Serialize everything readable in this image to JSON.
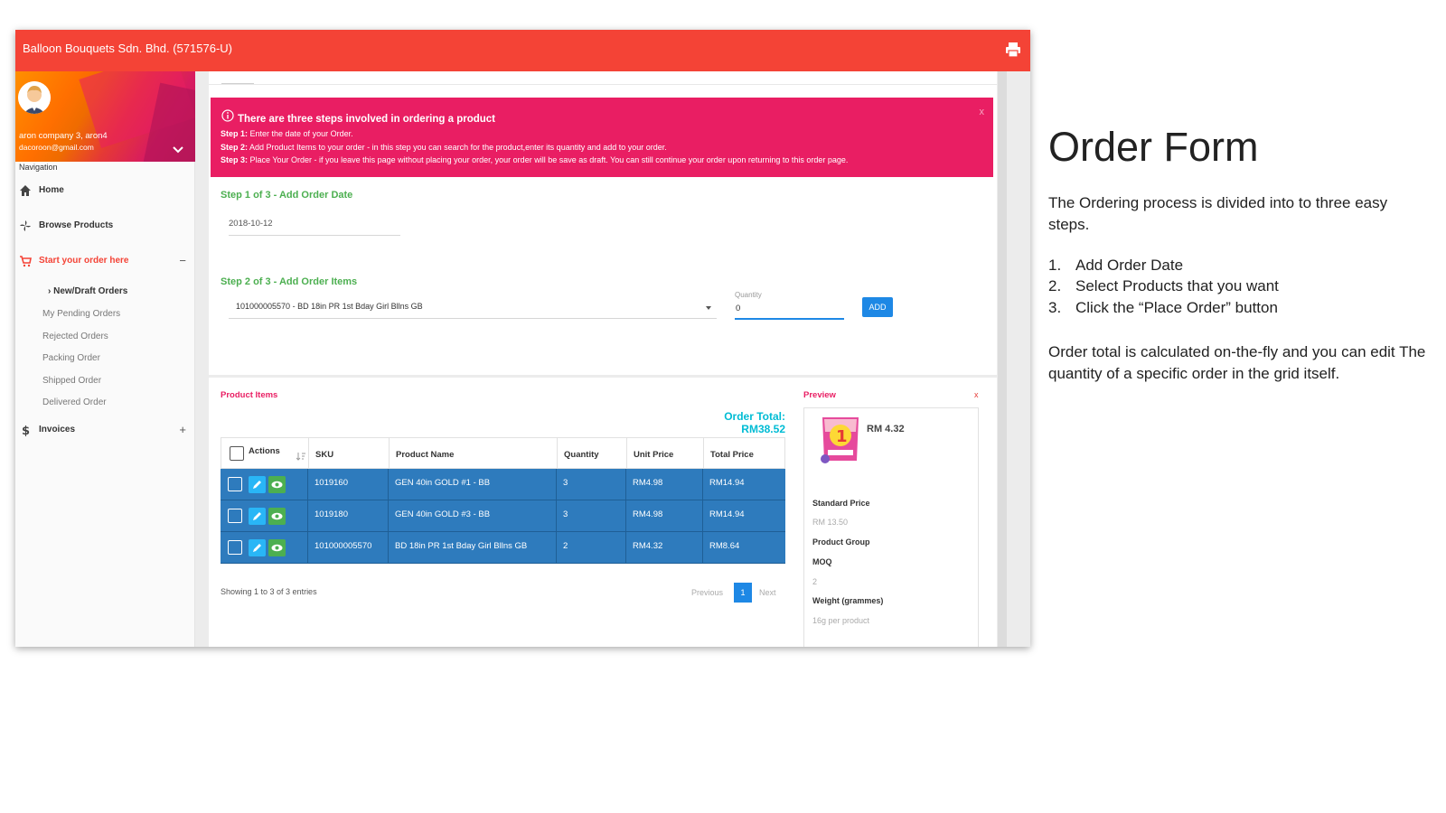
{
  "app": {
    "title": "Balloon Bouquets Sdn. Bhd. (571576-U)",
    "accent": "#f44336"
  },
  "sidebar": {
    "user_name": "aron company 3, aron4",
    "user_email": "dacoroon@gmail.com",
    "nav_label": "Navigation",
    "items": [
      {
        "label": "Home",
        "icon": "home-icon"
      },
      {
        "label": "Browse Products",
        "icon": "fan-icon"
      },
      {
        "label": "Start your order here",
        "icon": "cart-icon",
        "toggle": "−"
      },
      {
        "label": "Invoices",
        "icon": "dollar-icon",
        "toggle": "+"
      }
    ],
    "sub_items": [
      "New/Draft Orders",
      "My Pending Orders",
      "Rejected Orders",
      "Packing Order",
      "Shipped Order",
      "Delivered Order"
    ]
  },
  "alert": {
    "heading": "There are three steps involved in ordering a product",
    "close": "x",
    "steps": [
      {
        "label": "Step 1:",
        "text": " Enter the date of your Order."
      },
      {
        "label": "Step 2:",
        "text": " Add Product Items to your order - in this step you can search for the product,enter its quantity and add to your order."
      },
      {
        "label": "Step 3:",
        "text": " Place Your Order - if you leave this page without placing your order, your order will be save as draft. You can still continue your order upon returning to this order page."
      }
    ]
  },
  "form": {
    "step1_title": "Step 1 of 3 - Add Order Date",
    "order_date": "2018-10-12",
    "step2_title": "Step 2 of 3 - Add Order Items",
    "product_selected": "101000005570 - BD 18in PR 1st Bday Girl Bllns GB",
    "quantity_label": "Quantity",
    "quantity_value": "0",
    "add_label": "ADD"
  },
  "product_items": {
    "title": "Product Items",
    "order_total": "Order Total: RM38.52",
    "columns": [
      "Actions",
      "SKU",
      "Product Name",
      "Quantity",
      "Unit Price",
      "Total Price"
    ],
    "rows": [
      {
        "sku": "1019160",
        "name": "GEN 40in GOLD #1 - BB",
        "qty": "3",
        "unit": "RM4.98",
        "total": "RM14.94"
      },
      {
        "sku": "1019180",
        "name": "GEN 40in GOLD #3 - BB",
        "qty": "3",
        "unit": "RM4.98",
        "total": "RM14.94"
      },
      {
        "sku": "101000005570",
        "name": "BD 18in PR 1st Bday Girl Bllns GB",
        "qty": "2",
        "unit": "RM4.32",
        "total": "RM8.64"
      }
    ],
    "entries": "Showing 1 to 3 of 3 entries",
    "pagination": {
      "previous": "Previous",
      "current": "1",
      "next": "Next"
    }
  },
  "preview": {
    "title": "Preview",
    "close": "x",
    "price": "RM 4.32",
    "standard_price_label": "Standard Price",
    "standard_price": "RM 13.50",
    "product_group_label": "Product Group",
    "moq_label": "MOQ",
    "moq": "2",
    "weight_label": "Weight (grammes)",
    "weight": "16g per product"
  },
  "slide": {
    "title": "Order Form",
    "intro": "The Ordering process is divided into to three easy steps.",
    "steps": [
      {
        "num": "1.",
        "text": "Add Order Date"
      },
      {
        "num": "2.",
        "text": " Select Products that you want"
      },
      {
        "num": "3.",
        "text": "Click the “Place Order” button"
      }
    ],
    "note": "Order total is calculated on-the-fly and you can edit The quantity of a specific order in the grid itself."
  }
}
